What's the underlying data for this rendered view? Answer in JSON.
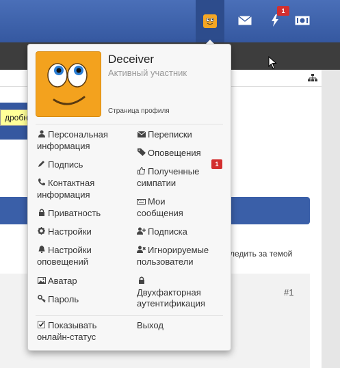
{
  "topbar": {
    "notifications_badge": "1",
    "icons": [
      "avatar-icon",
      "envelope-icon",
      "bolt-icon",
      "money-icon"
    ]
  },
  "page": {
    "tooltip": "дробне",
    "follow_link": "следить за темой",
    "post_number": "#1"
  },
  "user": {
    "name": "Deceiver",
    "title": "Активный участник",
    "profile_link": "Страница профиля"
  },
  "menu": {
    "left": [
      {
        "icon": "user-icon",
        "label": "Персональная информация"
      },
      {
        "icon": "pencil-icon",
        "label": "Подпись"
      },
      {
        "icon": "phone-icon",
        "label": "Контактная информация"
      },
      {
        "icon": "lock-icon",
        "label": "Приватность"
      },
      {
        "icon": "gear-icon",
        "label": "Настройки"
      },
      {
        "icon": "bell-icon",
        "label": "Настройки оповещений"
      },
      {
        "icon": "image-icon",
        "label": "Аватар"
      },
      {
        "icon": "key-icon",
        "label": "Пароль"
      }
    ],
    "right": [
      {
        "icon": "envelope-icon",
        "label": "Переписки"
      },
      {
        "icon": "tag-icon",
        "label": "Оповещения"
      },
      {
        "icon": "thumbs-up-icon",
        "label": "Полученные симпатии",
        "badge": "1"
      },
      {
        "icon": "keyboard-icon",
        "label": "Мои сообщения"
      },
      {
        "icon": "user-plus-icon",
        "label": "Подписка"
      },
      {
        "icon": "user-x-icon",
        "label": "Игнорируемые пользователи"
      },
      {
        "icon": "lock-icon",
        "label": "Двухфакторная аутентификация"
      }
    ],
    "show_online_status": "Показывать онлайн-статус",
    "show_online_checked": true,
    "logout": "Выход"
  }
}
